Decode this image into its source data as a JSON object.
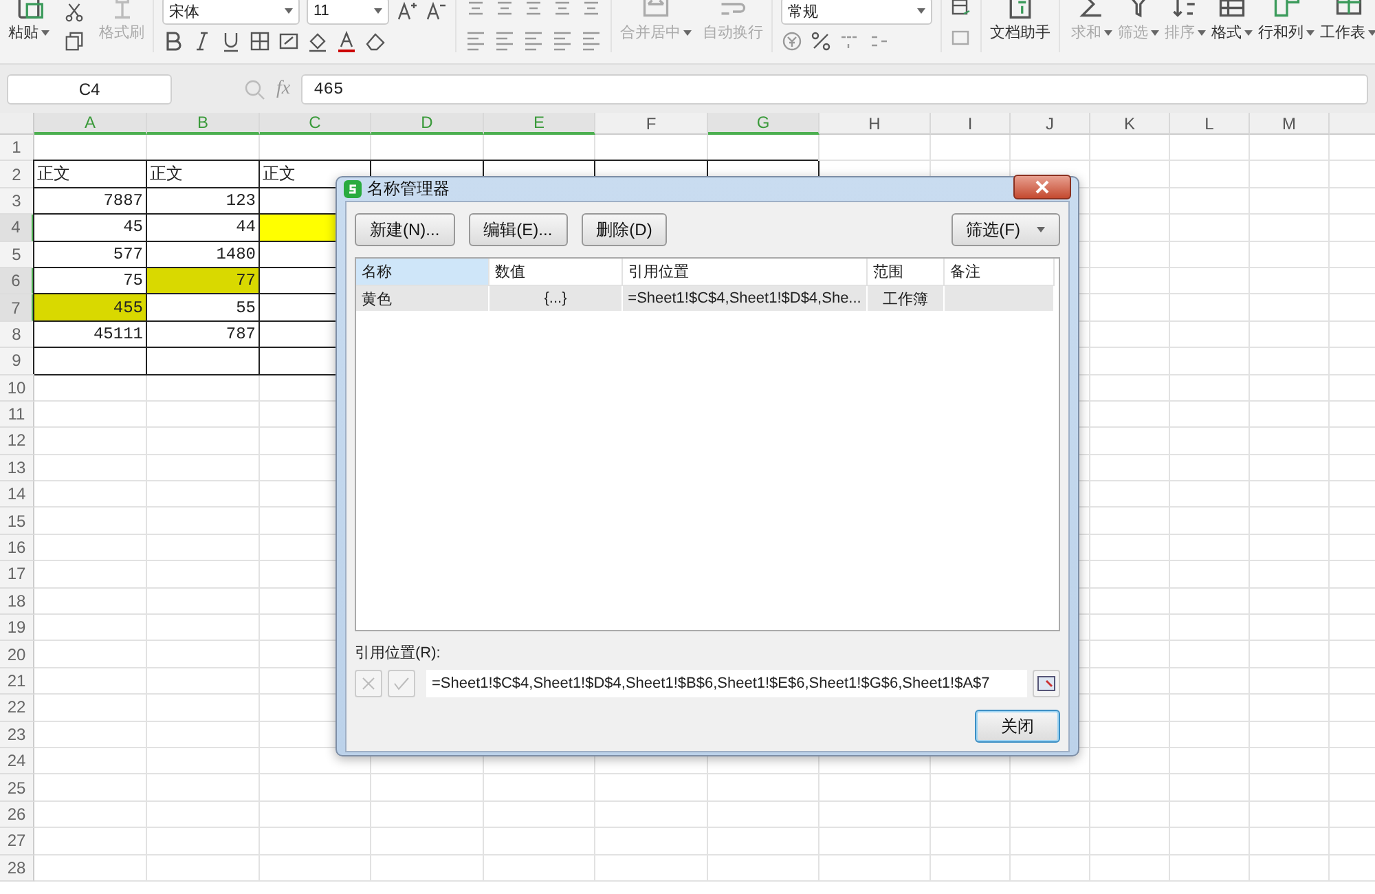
{
  "ribbon": {
    "paste": {
      "label": "粘贴"
    },
    "format_painter": {
      "label": "格式刷",
      "disabled": true
    },
    "font": "宋体",
    "font_size": "11",
    "merge": {
      "label": "合并居中",
      "disabled": true
    },
    "wrap": {
      "label": "自动换行",
      "disabled": true
    },
    "number_format": "常规",
    "assistant": "文档助手",
    "tools": [
      {
        "label": "求和",
        "disabled": true
      },
      {
        "label": "筛选",
        "disabled": true
      },
      {
        "label": "排序",
        "disabled": true
      },
      {
        "label": "格式",
        "disabled": false
      },
      {
        "label": "行和列",
        "disabled": false
      },
      {
        "label": "工作表",
        "disabled": false
      }
    ]
  },
  "formula_bar": {
    "name_box": "C4",
    "fx_label": "fx",
    "value": "465"
  },
  "sheet": {
    "columns": [
      {
        "label": "A",
        "selected": true
      },
      {
        "label": "B",
        "selected": true
      },
      {
        "label": "C",
        "selected": true
      },
      {
        "label": "D",
        "selected": true
      },
      {
        "label": "E",
        "selected": true
      },
      {
        "label": "F",
        "selected": false
      },
      {
        "label": "G",
        "selected": true
      },
      {
        "label": "H",
        "selected": false
      },
      {
        "label": "I",
        "selected": false
      },
      {
        "label": "J",
        "selected": false
      },
      {
        "label": "K",
        "selected": false
      },
      {
        "label": "L",
        "selected": false
      },
      {
        "label": "M",
        "selected": false
      }
    ],
    "rows": [
      {
        "label": "1",
        "selected": false,
        "bordered": false,
        "cells": []
      },
      {
        "label": "2",
        "selected": false,
        "bordered": true,
        "cells": [
          {
            "kind": "text",
            "text": "正文"
          },
          {
            "kind": "text",
            "text": "正文"
          },
          {
            "kind": "text",
            "text": "正文"
          }
        ]
      },
      {
        "label": "3",
        "selected": false,
        "bordered": true,
        "cells": [
          {
            "kind": "number",
            "text": "7887"
          },
          {
            "kind": "number",
            "text": "123"
          }
        ]
      },
      {
        "label": "4",
        "selected": true,
        "bordered": true,
        "cells": [
          {
            "kind": "number",
            "text": "45"
          },
          {
            "kind": "number",
            "text": "44"
          },
          {
            "kind": "empty",
            "color": "#ffff00"
          }
        ]
      },
      {
        "label": "5",
        "selected": false,
        "bordered": true,
        "cells": [
          {
            "kind": "number",
            "text": "577"
          },
          {
            "kind": "number",
            "text": "1480"
          }
        ]
      },
      {
        "label": "6",
        "selected": true,
        "bordered": true,
        "cells": [
          {
            "kind": "number",
            "text": "75"
          },
          {
            "kind": "number",
            "text": "77",
            "color": "#d9d900"
          }
        ]
      },
      {
        "label": "7",
        "selected": true,
        "bordered": true,
        "cells": [
          {
            "kind": "number",
            "text": "455",
            "color": "#d9d900"
          },
          {
            "kind": "number",
            "text": "55"
          }
        ]
      },
      {
        "label": "8",
        "selected": false,
        "bordered": true,
        "cells": [
          {
            "kind": "number",
            "text": "45111"
          },
          {
            "kind": "number",
            "text": "787"
          }
        ]
      },
      {
        "label": "9",
        "selected": false,
        "bordered": true,
        "cells": []
      },
      {
        "label": "10",
        "selected": false,
        "bordered": false,
        "cells": []
      },
      {
        "label": "11",
        "selected": false,
        "bordered": false,
        "cells": []
      },
      {
        "label": "12",
        "selected": false,
        "bordered": false,
        "cells": []
      },
      {
        "label": "13",
        "selected": false,
        "bordered": false,
        "cells": []
      },
      {
        "label": "14",
        "selected": false,
        "bordered": false,
        "cells": []
      },
      {
        "label": "15",
        "selected": false,
        "bordered": false,
        "cells": []
      },
      {
        "label": "16",
        "selected": false,
        "bordered": false,
        "cells": []
      },
      {
        "label": "17",
        "selected": false,
        "bordered": false,
        "cells": []
      },
      {
        "label": "18",
        "selected": false,
        "bordered": false,
        "cells": []
      },
      {
        "label": "19",
        "selected": false,
        "bordered": false,
        "cells": []
      },
      {
        "label": "20",
        "selected": false,
        "bordered": false,
        "cells": []
      },
      {
        "label": "21",
        "selected": false,
        "bordered": false,
        "cells": []
      },
      {
        "label": "22",
        "selected": false,
        "bordered": false,
        "cells": []
      },
      {
        "label": "23",
        "selected": false,
        "bordered": false,
        "cells": []
      },
      {
        "label": "24",
        "selected": false,
        "bordered": false,
        "cells": []
      },
      {
        "label": "25",
        "selected": false,
        "bordered": false,
        "cells": []
      },
      {
        "label": "26",
        "selected": false,
        "bordered": false,
        "cells": []
      },
      {
        "label": "27",
        "selected": false,
        "bordered": false,
        "cells": []
      },
      {
        "label": "28",
        "selected": false,
        "bordered": false,
        "cells": []
      }
    ]
  },
  "dialog": {
    "title": "名称管理器",
    "buttons": [
      "新建(N)...",
      "编辑(E)...",
      "删除(D)"
    ],
    "filter": "筛选(F)",
    "columns": [
      {
        "label": "名称",
        "selected": true
      },
      {
        "label": "数值",
        "selected": false
      },
      {
        "label": "引用位置",
        "selected": false
      },
      {
        "label": "范围",
        "selected": false
      },
      {
        "label": "备注",
        "selected": false
      }
    ],
    "names": [
      {
        "name": "黄色",
        "value": "{...}",
        "refers_to": "=Sheet1!$C$4,Sheet1!$D$4,She...",
        "scope": "工作簿",
        "selected": true
      }
    ],
    "refers_label": "引用位置(R):",
    "refers_value": "=Sheet1!$C$4,Sheet1!$D$4,Sheet1!$B$6,Sheet1!$E$6,Sheet1!$G$6,Sheet1!$A$7",
    "close": "关闭"
  }
}
